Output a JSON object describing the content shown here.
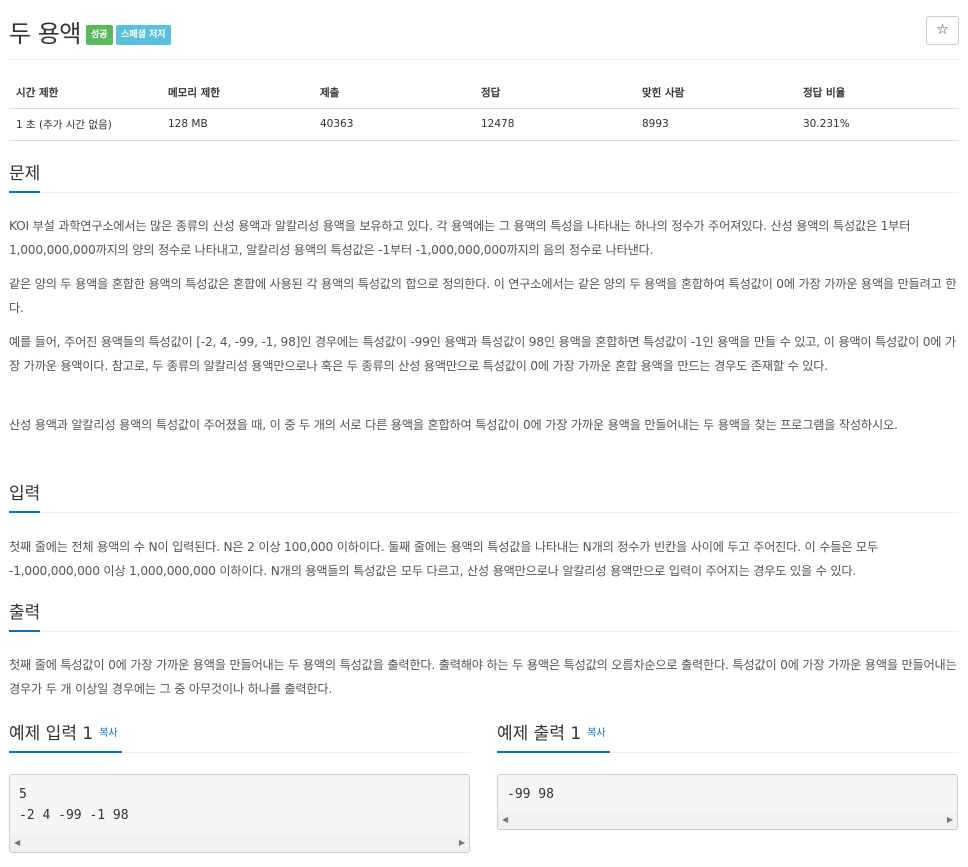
{
  "problem": {
    "title": "두 용액",
    "badges": {
      "success": "성공",
      "special": "스페셜 저지"
    },
    "star_icon": "☆"
  },
  "info_table": {
    "headers": [
      "시간 제한",
      "메모리 제한",
      "제출",
      "정답",
      "맞힌 사람",
      "정답 비율"
    ],
    "values": [
      "1 초 (추가 시간 없음)",
      "128 MB",
      "40363",
      "12478",
      "8993",
      "30.231%"
    ]
  },
  "sections": {
    "description": {
      "heading": "문제",
      "paragraphs": [
        "KOI 부설 과학연구소에서는 많은 종류의 산성 용액과 알칼리성 용액을 보유하고 있다. 각 용액에는 그 용액의 특성을 나타내는 하나의 정수가 주어져있다. 산성 용액의 특성값은 1부터 1,000,000,000까지의 양의 정수로 나타내고, 알칼리성 용액의 특성값은 -1부터 -1,000,000,000까지의 음의 정수로 나타낸다.",
        "같은 양의 두 용액을 혼합한 용액의 특성값은 혼합에 사용된 각 용액의 특성값의 합으로 정의한다. 이 연구소에서는 같은 양의 두 용액을 혼합하여 특성값이 0에 가장 가까운 용액을 만들려고 한다.",
        "예를 들어, 주어진 용액들의 특성값이 [-2, 4, -99, -1, 98]인 경우에는 특성값이 -99인 용액과 특성값이 98인 용액을 혼합하면 특성값이 -1인 용액을 만들 수 있고, 이 용액이 특성값이 0에 가장 가까운 용액이다. 참고로, 두 종류의 알칼리성 용액만으로나 혹은 두 종류의 산성 용액만으로 특성값이 0에 가장 가까운 혼합 용액을 만드는 경우도 존재할 수 있다.",
        "산성 용액과 알칼리성 용액의 특성값이 주어졌을 때, 이 중 두 개의 서로 다른 용액을 혼합하여 특성값이 0에 가장 가까운 용액을 만들어내는 두 용액을 찾는 프로그램을 작성하시오."
      ]
    },
    "input": {
      "heading": "입력",
      "paragraph": "첫째 줄에는 전체 용액의 수 N이 입력된다. N은 2 이상 100,000 이하이다. 둘째 줄에는 용액의 특성값을 나타내는 N개의 정수가 빈칸을 사이에 두고 주어진다. 이 수들은 모두 -1,000,000,000 이상 1,000,000,000 이하이다. N개의 용액들의 특성값은 모두 다르고, 산성 용액만으로나 알칼리성 용액만으로 입력이 주어지는 경우도 있을 수 있다."
    },
    "output": {
      "heading": "출력",
      "paragraph": "첫째 줄에 특성값이 0에 가장 가까운 용액을 만들어내는 두 용액의 특성값을 출력한다. 출력해야 하는 두 용액은 특성값의 오름차순으로 출력한다. 특성값이 0에 가장 가까운 용액을 만들어내는 경우가 두 개 이상일 경우에는 그 중 아무것이나 하나를 출력한다."
    }
  },
  "samples": {
    "input": {
      "heading": "예제 입력 1",
      "copy_label": "복사",
      "content": "5\n-2 4 -99 -1 98"
    },
    "output": {
      "heading": "예제 출력 1",
      "copy_label": "복사",
      "content": "-99 98"
    },
    "scroll_left_icon": "◀",
    "scroll_right_icon": "▶"
  },
  "colors": {
    "accent": "#0076c0",
    "success": "#5cb85c",
    "info": "#5bc0de"
  }
}
